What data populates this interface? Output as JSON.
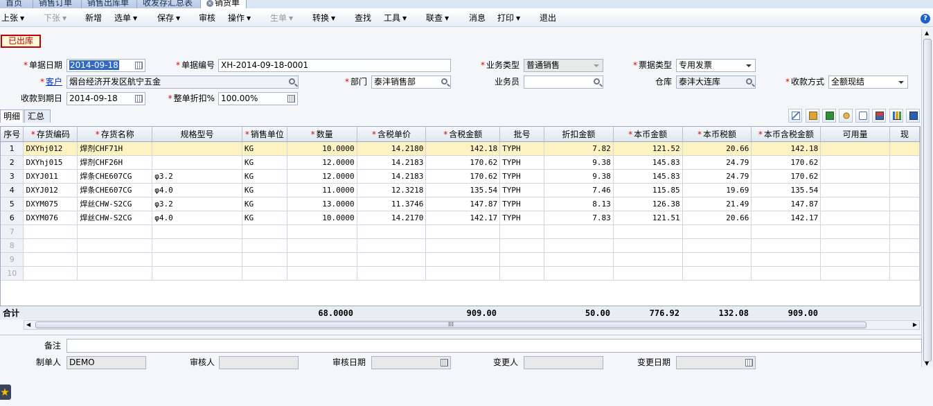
{
  "tabs": [
    {
      "label": "首页",
      "active": false
    },
    {
      "label": "销售订单",
      "active": false
    },
    {
      "label": "销售出库单",
      "active": false
    },
    {
      "label": "收发存汇总表",
      "active": false
    },
    {
      "label": "销货单",
      "active": true
    }
  ],
  "menu": [
    {
      "label": "上张",
      "dropdown": true,
      "disabled": false
    },
    {
      "label": "下张",
      "dropdown": true,
      "disabled": true
    },
    {
      "label": "新增",
      "dropdown": false,
      "disabled": false
    },
    {
      "label": "选单",
      "dropdown": true,
      "disabled": false
    },
    {
      "label": "保存",
      "dropdown": true,
      "disabled": false
    },
    {
      "label": "审核",
      "dropdown": false,
      "disabled": false
    },
    {
      "label": "操作",
      "dropdown": true,
      "disabled": false
    },
    {
      "label": "生单",
      "dropdown": true,
      "disabled": true
    },
    {
      "label": "转换",
      "dropdown": true,
      "disabled": false
    },
    {
      "label": "查找",
      "dropdown": false,
      "disabled": false
    },
    {
      "label": "工具",
      "dropdown": true,
      "disabled": false
    },
    {
      "label": "联查",
      "dropdown": true,
      "disabled": false
    },
    {
      "label": "消息",
      "dropdown": false,
      "disabled": false
    },
    {
      "label": "打印",
      "dropdown": true,
      "disabled": false
    },
    {
      "label": "退出",
      "dropdown": false,
      "disabled": false
    }
  ],
  "status_stamp": "已出库",
  "form": {
    "doc_date_label": "单据日期",
    "doc_date": "2014-09-18",
    "doc_no_label": "单据编号",
    "doc_no": "XH-2014-09-18-0001",
    "biz_type_label": "业务类型",
    "biz_type": "普通销售",
    "invoice_type_label": "票据类型",
    "invoice_type": "专用发票",
    "customer_label": "客户",
    "customer": "烟台经济开发区航宁五金",
    "dept_label": "部门",
    "dept": "泰沣销售部",
    "salesman_label": "业务员",
    "salesman": "",
    "warehouse_label": "仓库",
    "warehouse": "泰沣大连库",
    "payment_label": "收款方式",
    "payment": "全额现结",
    "due_date_label": "收款到期日",
    "due_date": "2014-09-18",
    "discount_label": "整单折扣%",
    "discount": "100.00%"
  },
  "subtabs": [
    "明细",
    "汇总"
  ],
  "toolbar_icons": [
    "copy-row-icon",
    "paste-icon",
    "excel-export-icon",
    "search-settings-icon",
    "locate-icon",
    "save-layout-icon",
    "chart-icon",
    "save-icon"
  ],
  "grid": {
    "columns": [
      {
        "label": "序号",
        "required": false
      },
      {
        "label": "存货编码",
        "required": true
      },
      {
        "label": "存货名称",
        "required": true
      },
      {
        "label": "规格型号",
        "required": false
      },
      {
        "label": "销售单位",
        "required": true
      },
      {
        "label": "数量",
        "required": true
      },
      {
        "label": "含税单价",
        "required": true
      },
      {
        "label": "含税金额",
        "required": true
      },
      {
        "label": "批号",
        "required": false
      },
      {
        "label": "折扣金额",
        "required": false
      },
      {
        "label": "本币金额",
        "required": true
      },
      {
        "label": "本币税额",
        "required": true
      },
      {
        "label": "本币含税金额",
        "required": true
      },
      {
        "label": "可用量",
        "required": false
      },
      {
        "label": "现",
        "required": false
      }
    ],
    "rows": [
      [
        "1",
        "DXYhj012",
        "焊剂CHF71H",
        "",
        "KG",
        "10.0000",
        "14.2180",
        "142.18",
        "TYPH",
        "7.82",
        "121.52",
        "20.66",
        "142.18",
        "",
        ""
      ],
      [
        "2",
        "DXYhj015",
        "焊剂CHF26H",
        "",
        "KG",
        "12.0000",
        "14.2183",
        "170.62",
        "TYPH",
        "9.38",
        "145.83",
        "24.79",
        "170.62",
        "",
        ""
      ],
      [
        "3",
        "DXYJ011",
        "焊条CHE607CG",
        "φ3.2",
        "KG",
        "12.0000",
        "14.2183",
        "170.62",
        "TYPH",
        "9.38",
        "145.83",
        "24.79",
        "170.62",
        "",
        ""
      ],
      [
        "4",
        "DXYJ012",
        "焊条CHE607CG",
        "φ4.0",
        "KG",
        "11.0000",
        "12.3218",
        "135.54",
        "TYPH",
        "7.46",
        "115.85",
        "19.69",
        "135.54",
        "",
        ""
      ],
      [
        "5",
        "DXYM075",
        "焊丝CHW-S2CG",
        "φ3.2",
        "KG",
        "13.0000",
        "11.3746",
        "147.87",
        "TYPH",
        "8.13",
        "126.38",
        "21.49",
        "147.87",
        "",
        ""
      ],
      [
        "6",
        "DXYM076",
        "焊丝CHW-S2CG",
        "φ4.0",
        "KG",
        "10.0000",
        "14.2170",
        "142.17",
        "TYPH",
        "7.83",
        "121.51",
        "20.66",
        "142.17",
        "",
        ""
      ]
    ],
    "empty_rows": [
      "7",
      "8",
      "9",
      "10"
    ],
    "totals": {
      "label": "合计",
      "qty": "68.0000",
      "amount": "909.00",
      "discount": "50.00",
      "base_amount": "776.92",
      "base_tax": "132.08",
      "base_total": "909.00"
    }
  },
  "footer": {
    "remark_label": "备注",
    "remark": "",
    "creator_label": "制单人",
    "creator": "DEMO",
    "auditor_label": "审核人",
    "auditor": "",
    "audit_date_label": "审核日期",
    "audit_date": "",
    "modifier_label": "变更人",
    "modifier": "",
    "modify_date_label": "变更日期",
    "modify_date": ""
  },
  "scroll_thumb_label": "III",
  "colors": {
    "accent": "#316ac5",
    "required": "#e00000",
    "stamp": "#c00000",
    "highlight_row": "#fdf2c2"
  }
}
